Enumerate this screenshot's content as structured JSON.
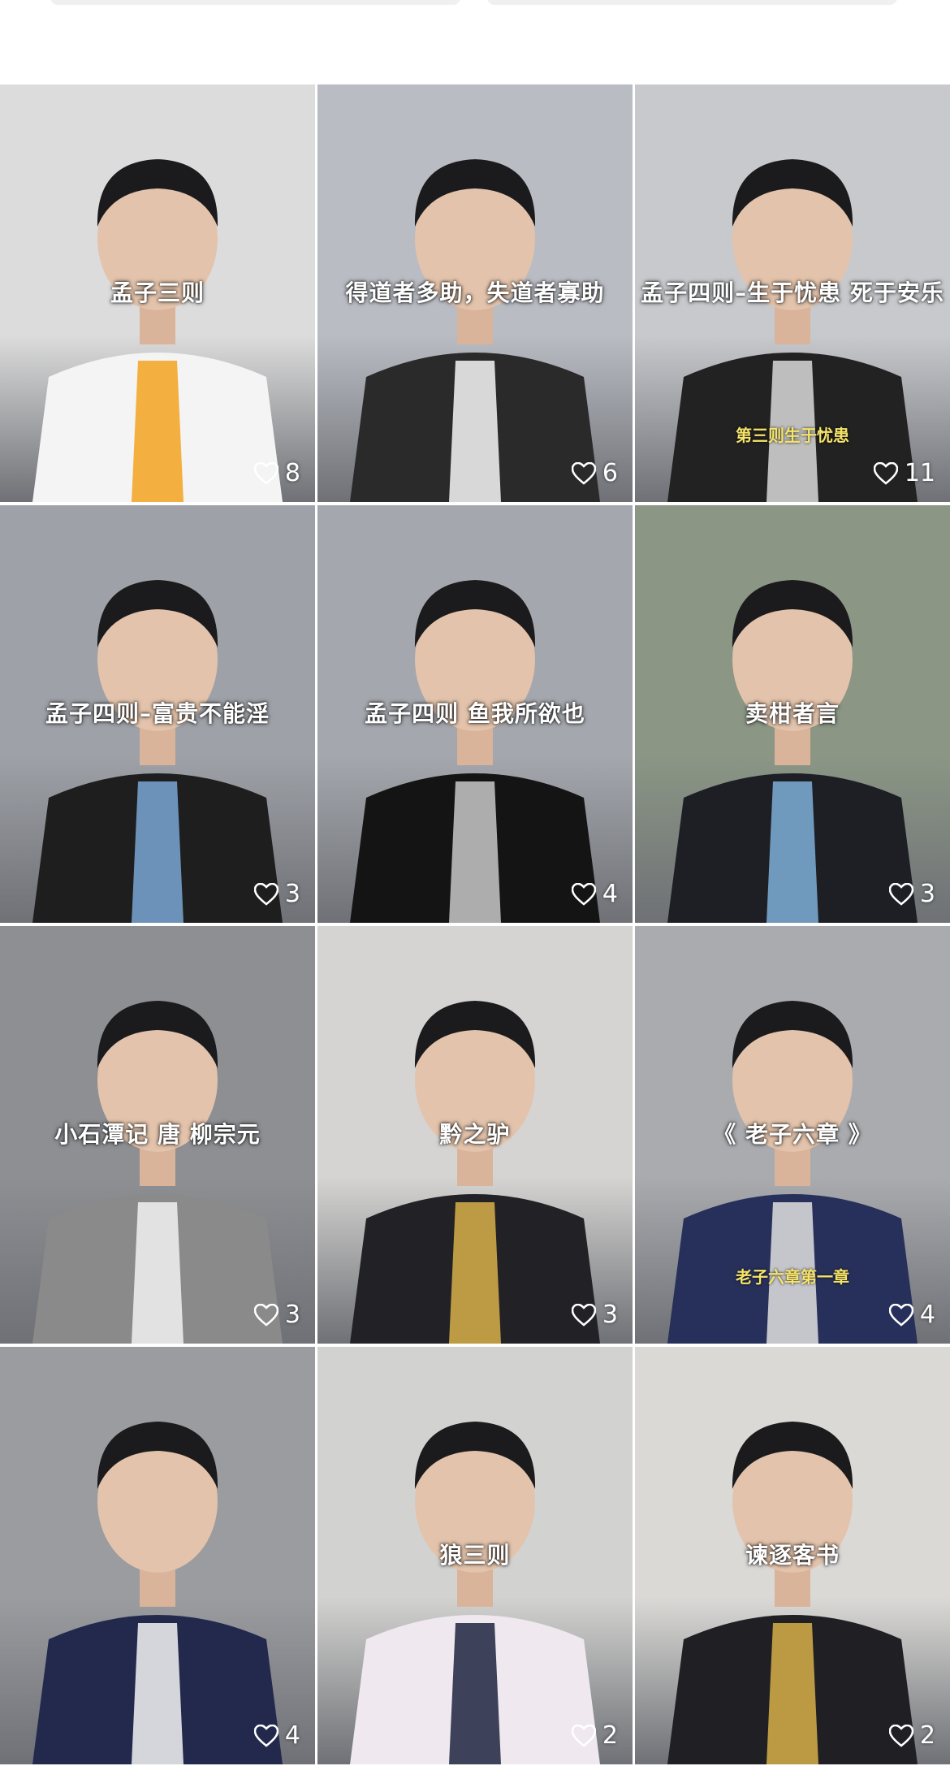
{
  "videos": [
    {
      "title": "孟子三则",
      "subtitle": "",
      "likes": "8",
      "bg": "#dcdcdc",
      "shirt": "#f4f4f4",
      "accent": "#f2a21f"
    },
    {
      "title": "得道者多助，失道者寡助",
      "subtitle": "",
      "likes": "6",
      "bg": "#b9bcc3",
      "shirt": "#2a2a2a",
      "accent": "#f7f7f7"
    },
    {
      "title": "孟子四则–生于忧患 死于安乐",
      "subtitle": "第三则生于忧患",
      "likes": "11",
      "bg": "#c7c9cd",
      "shirt": "#222222",
      "accent": "#d9d9d9"
    },
    {
      "title": "孟子四则–富贵不能淫",
      "subtitle": "",
      "likes": "3",
      "bg": "#9ea1a7",
      "shirt": "#1e1e1e",
      "accent": "#7aa7d6"
    },
    {
      "title": "孟子四则 鱼我所欲也",
      "subtitle": "",
      "likes": "4",
      "bg": "#a4a7ad",
      "shirt": "#141414",
      "accent": "#c8c8c8"
    },
    {
      "title": "卖柑者言",
      "subtitle": "",
      "likes": "3",
      "bg": "#8b9685",
      "shirt": "#1d1f25",
      "accent": "#7fb0d8"
    },
    {
      "title": "小石潭记 唐 柳宗元",
      "subtitle": "",
      "likes": "3",
      "bg": "#8d8f93",
      "shirt": "#8a8a8a",
      "accent": "#f1f1f1"
    },
    {
      "title": "黔之驴",
      "subtitle": "",
      "likes": "3",
      "bg": "#d5d4d2",
      "shirt": "#222226",
      "accent": "#d8b04a"
    },
    {
      "title": "《 老子六章 》",
      "subtitle": "老子六章第一章",
      "likes": "4",
      "bg": "#a9abaf",
      "shirt": "#27305a",
      "accent": "#e0e0e0"
    },
    {
      "title": "",
      "subtitle": "",
      "likes": "4",
      "bg": "#9a9ca0",
      "shirt": "#23294d",
      "accent": "#f4f4f4"
    },
    {
      "title": "狼三则",
      "subtitle": "",
      "likes": "2",
      "bg": "#d2d2d0",
      "shirt": "#efe8ef",
      "accent": "#1d2440"
    },
    {
      "title": "谏逐客书",
      "subtitle": "",
      "likes": "2",
      "bg": "#dad9d6",
      "shirt": "#1f1f24",
      "accent": "#d8b04a"
    }
  ]
}
